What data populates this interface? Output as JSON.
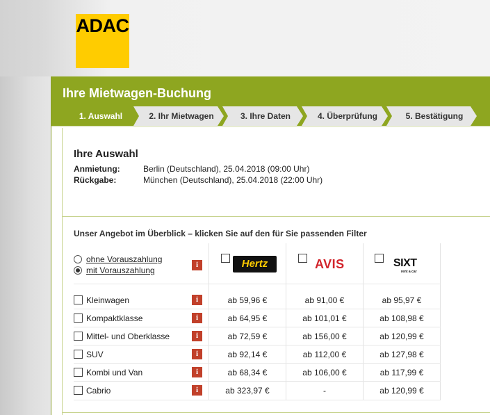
{
  "logo": {
    "text": "ADAC",
    "color": "#ffcc00"
  },
  "header": {
    "title": "Ihre Mietwagen-Buchung",
    "accent": "#8ea620",
    "steps": [
      {
        "label": "1. Auswahl",
        "active": true
      },
      {
        "label": "2. Ihr Mietwagen",
        "active": false
      },
      {
        "label": "3. Ihre Daten",
        "active": false
      },
      {
        "label": "4. Überprüfung",
        "active": false
      },
      {
        "label": "5. Bestätigung",
        "active": false
      }
    ]
  },
  "selection": {
    "title": "Ihre Auswahl",
    "pickup_label": "Anmietung:",
    "pickup_value": "Berlin (Deutschland), 25.04.2018 (09:00 Uhr)",
    "return_label": "Rückgabe:",
    "return_value": "München (Deutschland), 25.04.2018 (22:00 Uhr)"
  },
  "offers": {
    "title": "Unser Angebot im Überblick – klicken Sie auf den für Sie passenden Filter",
    "payment_options": [
      {
        "label": "ohne Vorauszahlung",
        "selected": false
      },
      {
        "label": "mit Vorauszahlung",
        "selected": true
      }
    ],
    "info_icon": "info-icon",
    "providers": [
      {
        "name": "Hertz",
        "checked": false
      },
      {
        "name": "AVIS",
        "checked": false
      },
      {
        "name": "SIXT",
        "sub": "rent a car",
        "checked": false
      }
    ],
    "categories": [
      {
        "name": "Kleinwagen",
        "prices": [
          "ab 59,96 €",
          "ab 91,00 €",
          "ab 95,97 €"
        ]
      },
      {
        "name": "Kompaktklasse",
        "prices": [
          "ab 64,95 €",
          "ab 101,01 €",
          "ab 108,98 €"
        ]
      },
      {
        "name": "Mittel- und Oberklasse",
        "prices": [
          "ab 72,59 €",
          "ab 156,00 €",
          "ab 120,99 €"
        ]
      },
      {
        "name": "SUV",
        "prices": [
          "ab 92,14 €",
          "ab 112,00 €",
          "ab 127,98 €"
        ]
      },
      {
        "name": "Kombi und Van",
        "prices": [
          "ab 68,34 €",
          "ab 106,00 €",
          "ab 117,99 €"
        ]
      },
      {
        "name": "Cabrio",
        "prices": [
          "ab 323,97 €",
          "-",
          "ab 120,99 €"
        ]
      }
    ]
  }
}
